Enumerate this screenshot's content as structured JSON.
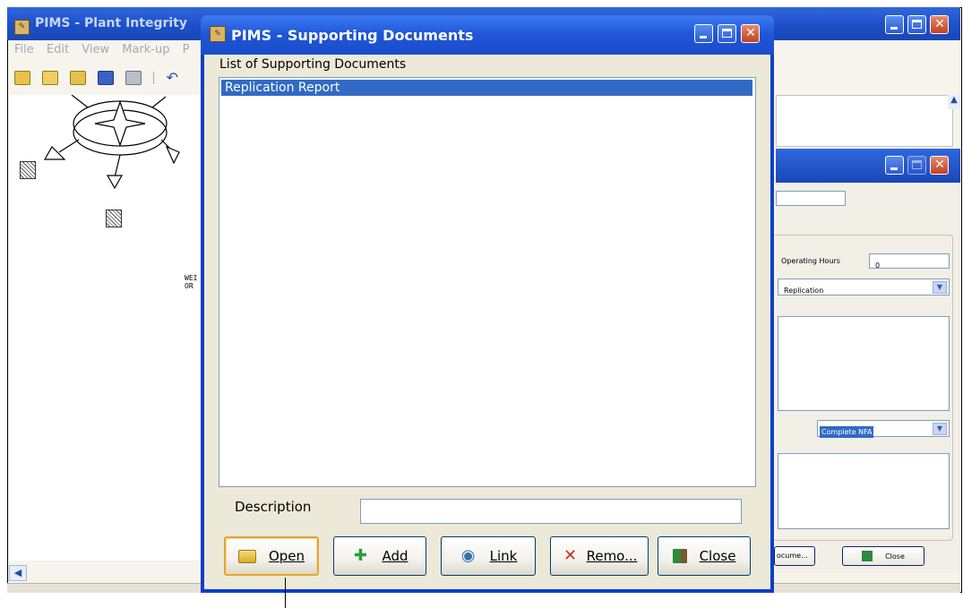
{
  "main_window": {
    "title": "PIMS - Plant Integrity",
    "menu": [
      "File",
      "Edit",
      "View",
      "Mark-up",
      "P"
    ],
    "canvas_labels": [
      "WEI",
      "OR"
    ]
  },
  "secondary_window": {
    "operating_hours_label": "Operating Hours",
    "operating_hours_value": "0",
    "type_value": "Replication",
    "status_value": "Complete NFA",
    "documents_button": "ocume...",
    "close_button": "Close"
  },
  "dialog": {
    "title": "PIMS - Supporting Documents",
    "list_caption": "List of Supporting Documents",
    "documents": [
      "Replication Report"
    ],
    "description_label": "Description",
    "description_value": "",
    "buttons": {
      "open": "Open",
      "add": "Add",
      "link": "Link",
      "remove": "Remo...",
      "close": "Close"
    }
  },
  "colors": {
    "title_blue": "#1f55d6",
    "selection": "#316ac5",
    "dialog_face": "#ece9d8",
    "close_red": "#c4401f"
  }
}
